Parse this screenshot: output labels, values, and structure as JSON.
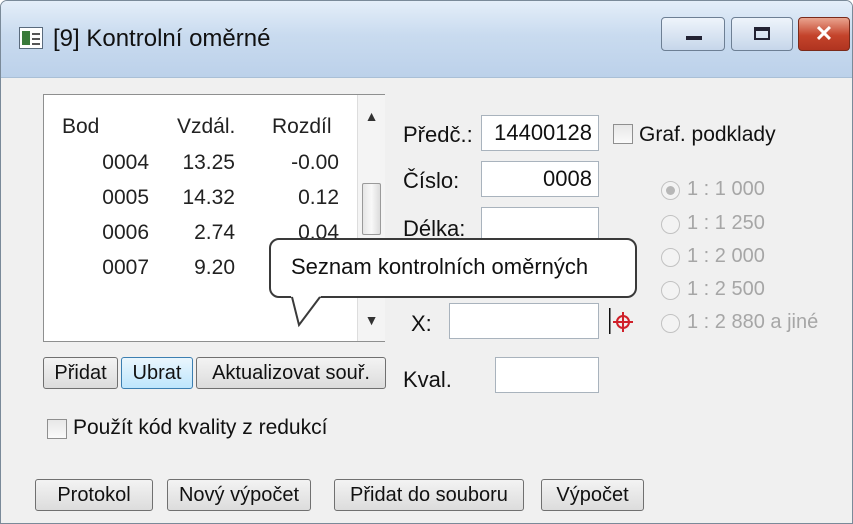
{
  "window": {
    "title": "[9] Kontrolní oměrné",
    "minimize_glyph": "",
    "maximize_glyph": "",
    "close_glyph": "✕"
  },
  "list": {
    "headers": [
      "Bod",
      "Vzdál.",
      "Rozdíl"
    ],
    "rows": [
      {
        "bod": "0004",
        "vzdal": "13.25",
        "rozdil": "-0.00"
      },
      {
        "bod": "0005",
        "vzdal": "14.32",
        "rozdil": "0.12"
      },
      {
        "bod": "0006",
        "vzdal": "2.74",
        "rozdil": "0.04"
      },
      {
        "bod": "0007",
        "vzdal": "9.20",
        "rozdil": ""
      }
    ],
    "scroll_up_glyph": "▲",
    "scroll_down_glyph": "▼"
  },
  "fields": {
    "predc_label": "Předč.:",
    "predc_value": "14400128",
    "cislo_label": "Číslo:",
    "cislo_value": "0008",
    "delka_label": "Délka:",
    "delka_value": "",
    "x_label": "X:",
    "x_value": "",
    "kval_label": "Kval.",
    "kval_value": ""
  },
  "graf": {
    "checkbox_label": "Graf. podklady",
    "checked": false,
    "scales": [
      "1 : 1 000",
      "1 : 1 250",
      "1 : 2 000",
      "1 : 2 500",
      "1 : 2 880 a jiné"
    ],
    "selected_index": 0
  },
  "list_buttons": {
    "add": "Přidat",
    "remove": "Ubrat",
    "update": "Aktualizovat souř."
  },
  "quality_checkbox": {
    "label": "Použít kód kvality z redukcí",
    "checked": false
  },
  "bottom_buttons": {
    "protocol": "Protokol",
    "new_calc": "Nový výpočet",
    "add_to_file": "Přidat do souboru",
    "calc": "Výpočet"
  },
  "tooltip": {
    "text": "Seznam kontrolních oměrných"
  },
  "colors": {
    "crosshair": "#d0202a",
    "titlebar": "#c9dbef",
    "close_button": "#c4432b"
  }
}
